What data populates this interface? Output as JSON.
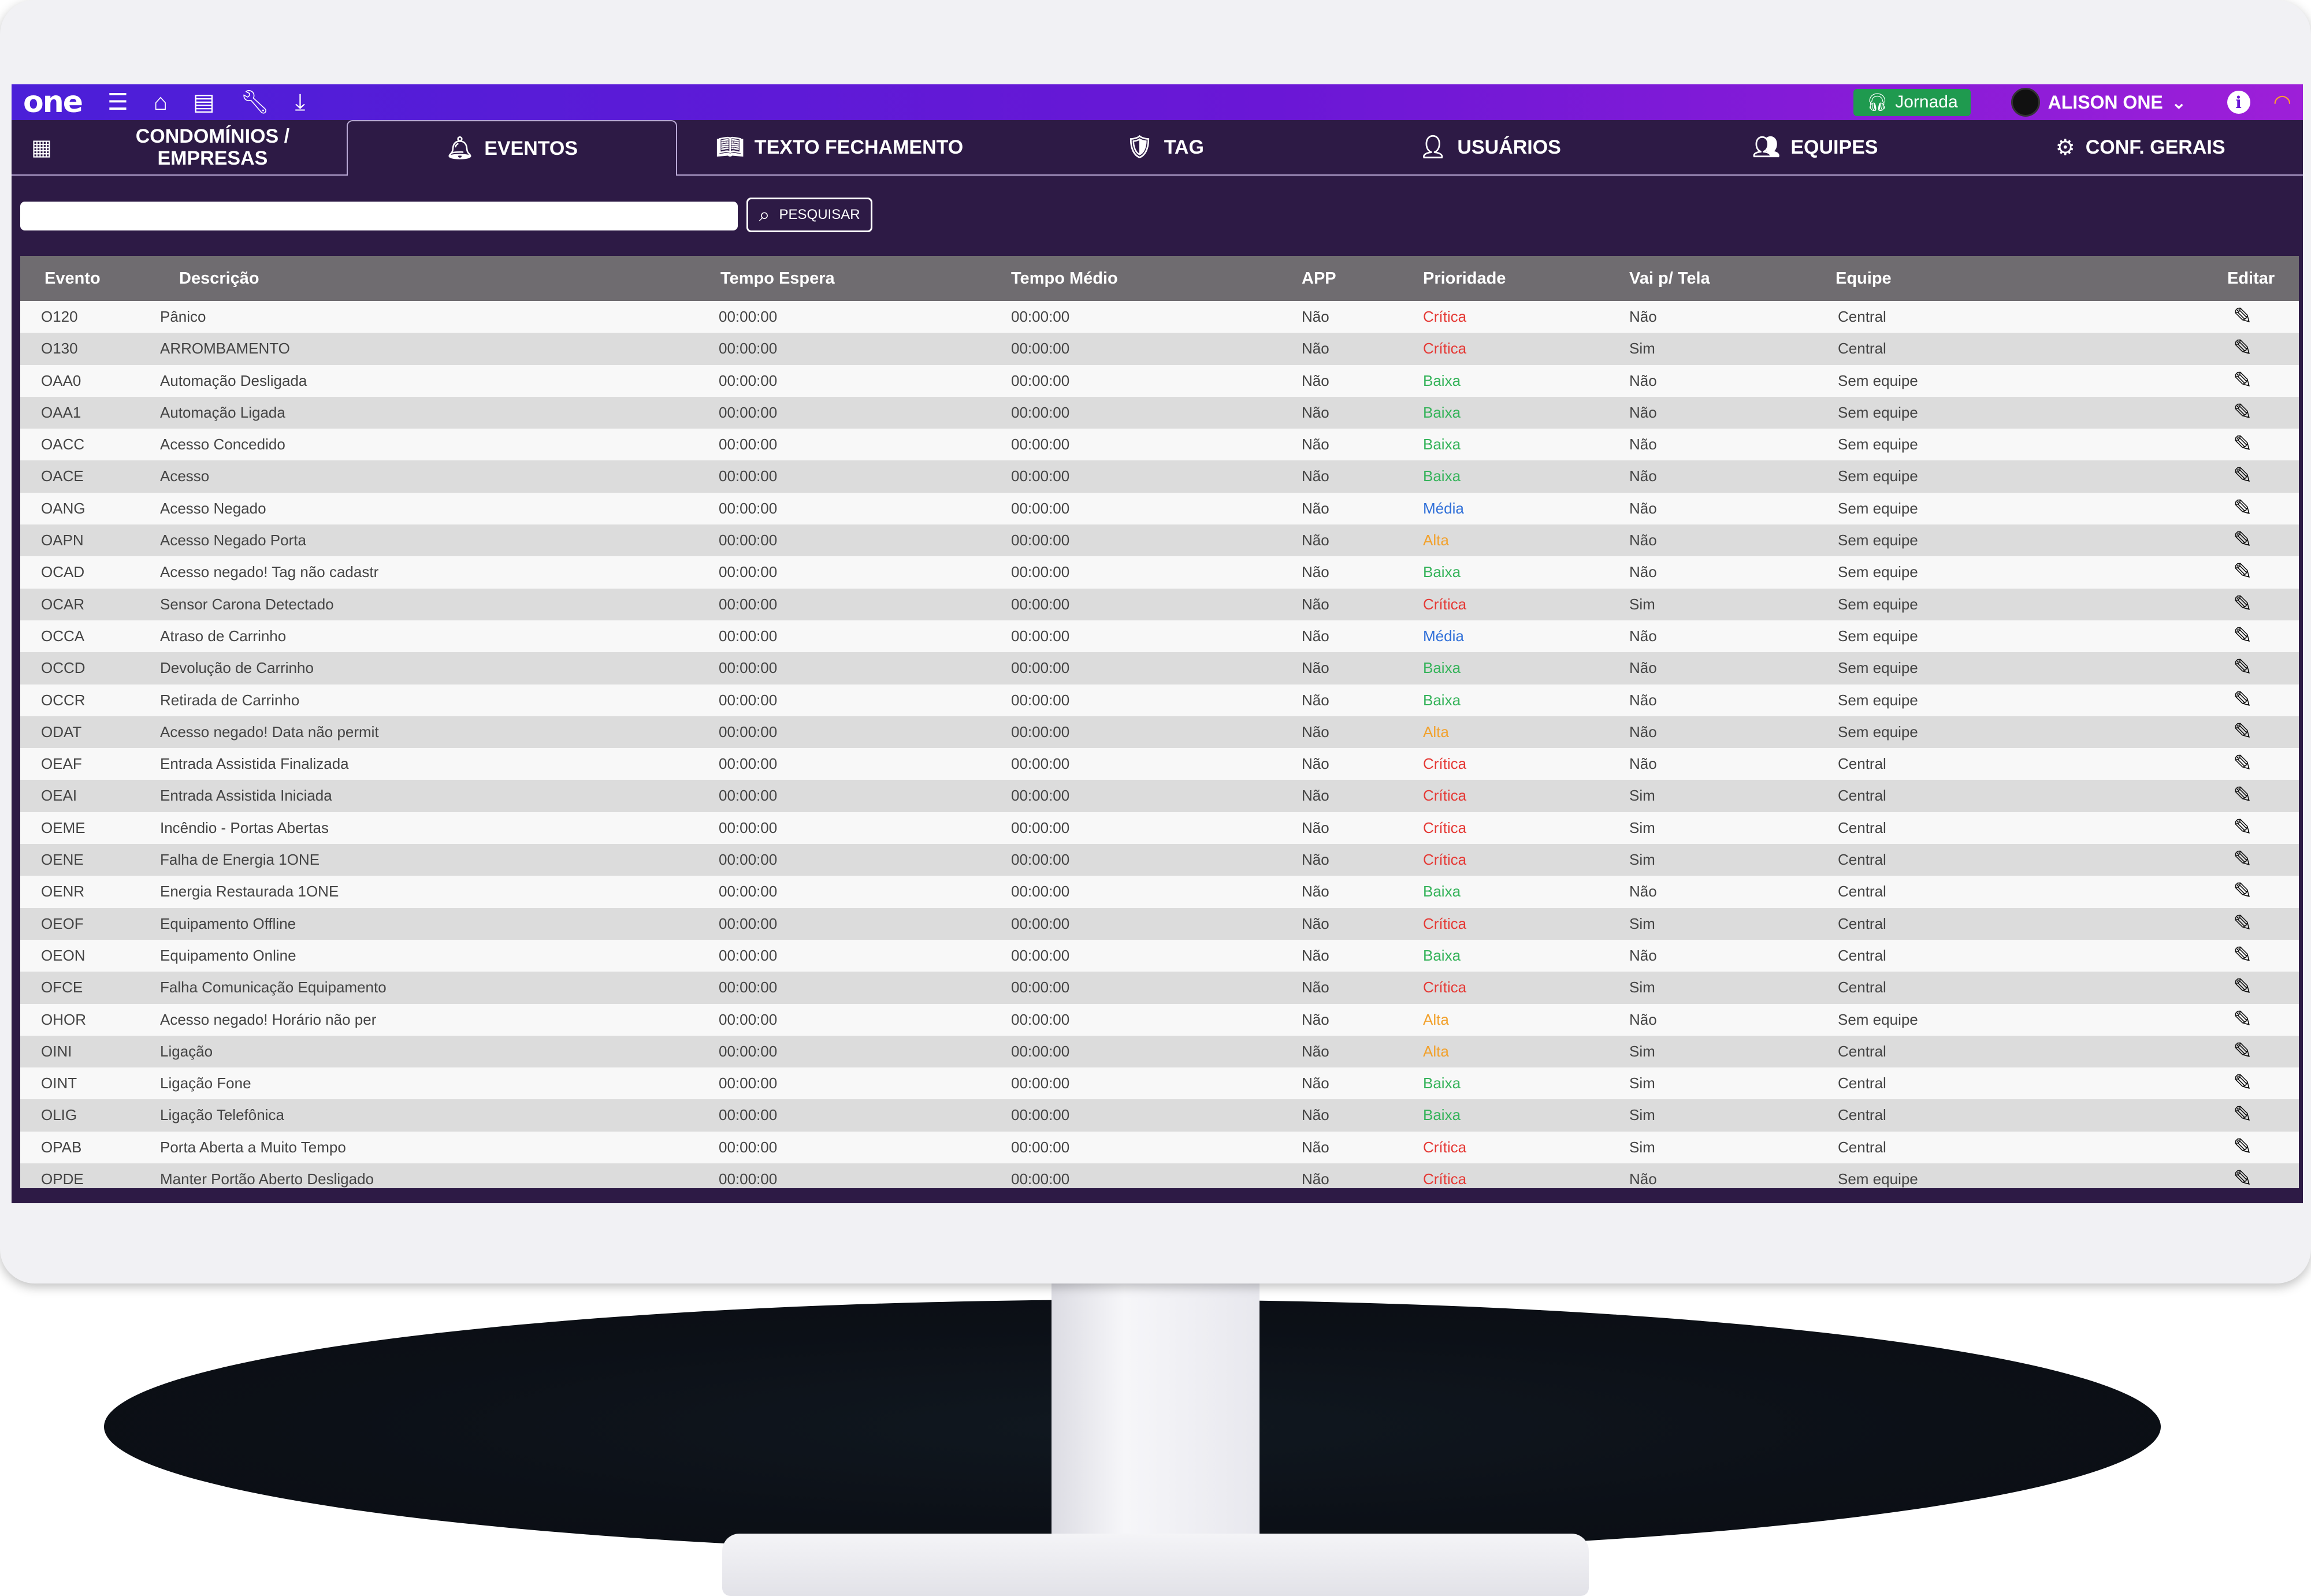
{
  "app": {
    "logo": "one",
    "jornada_label": "Jornada",
    "user_name": "ALISON ONE"
  },
  "icons": {
    "menu": "menu-icon",
    "home": "home-icon",
    "report": "report-icon",
    "tools": "wrench-icon",
    "download": "download-icon",
    "info": "info-icon",
    "wifi": "wifi-icon"
  },
  "colors": {
    "topbar_start": "#4b1fd8",
    "topbar_end": "#9d1fd8",
    "background": "#2d1a45",
    "jornada": "#1f9a4f",
    "critica": "#e53935",
    "baixa": "#35b35a",
    "media": "#2f6fd8",
    "alta": "#f2a12c"
  },
  "tabs": [
    {
      "label": "CONDOMÍNIOS /\nEMPRESAS",
      "icon": "building-icon"
    },
    {
      "label": "EVENTOS",
      "icon": "bell-icon",
      "active": true
    },
    {
      "label": "TEXTO FECHAMENTO",
      "icon": "book-icon"
    },
    {
      "label": "TAG",
      "icon": "shield-check-icon"
    },
    {
      "label": "USUÁRIOS",
      "icon": "user-check-icon"
    },
    {
      "label": "EQUIPES",
      "icon": "users-icon"
    },
    {
      "label": "CONF. GERAIS",
      "icon": "gear-icon"
    }
  ],
  "search": {
    "placeholder": "",
    "button_label": "PESQUISAR"
  },
  "table": {
    "columns": [
      "Evento",
      "Descrição",
      "Tempo Espera",
      "Tempo Médio",
      "APP",
      "Prioridade",
      "Vai p/ Tela",
      "Equipe",
      "Editar"
    ],
    "rows": [
      {
        "evento": "O120",
        "descricao": "Pânico",
        "espera": "00:00:00",
        "medio": "00:00:00",
        "app": "Não",
        "prioridade": "Crítica",
        "tela": "Não",
        "equipe": "Central"
      },
      {
        "evento": "O130",
        "descricao": "ARROMBAMENTO",
        "espera": "00:00:00",
        "medio": "00:00:00",
        "app": "Não",
        "prioridade": "Crítica",
        "tela": "Sim",
        "equipe": "Central"
      },
      {
        "evento": "OAA0",
        "descricao": "Automação Desligada",
        "espera": "00:00:00",
        "medio": "00:00:00",
        "app": "Não",
        "prioridade": "Baixa",
        "tela": "Não",
        "equipe": "Sem equipe"
      },
      {
        "evento": "OAA1",
        "descricao": "Automação Ligada",
        "espera": "00:00:00",
        "medio": "00:00:00",
        "app": "Não",
        "prioridade": "Baixa",
        "tela": "Não",
        "equipe": "Sem equipe"
      },
      {
        "evento": "OACC",
        "descricao": "Acesso Concedido",
        "espera": "00:00:00",
        "medio": "00:00:00",
        "app": "Não",
        "prioridade": "Baixa",
        "tela": "Não",
        "equipe": "Sem equipe"
      },
      {
        "evento": "OACE",
        "descricao": "Acesso",
        "espera": "00:00:00",
        "medio": "00:00:00",
        "app": "Não",
        "prioridade": "Baixa",
        "tela": "Não",
        "equipe": "Sem equipe"
      },
      {
        "evento": "OANG",
        "descricao": "Acesso Negado",
        "espera": "00:00:00",
        "medio": "00:00:00",
        "app": "Não",
        "prioridade": "Média",
        "tela": "Não",
        "equipe": "Sem equipe"
      },
      {
        "evento": "OAPN",
        "descricao": "Acesso Negado Porta",
        "espera": "00:00:00",
        "medio": "00:00:00",
        "app": "Não",
        "prioridade": "Alta",
        "tela": "Não",
        "equipe": "Sem equipe"
      },
      {
        "evento": "OCAD",
        "descricao": "Acesso negado! Tag não cadastr",
        "espera": "00:00:00",
        "medio": "00:00:00",
        "app": "Não",
        "prioridade": "Baixa",
        "tela": "Não",
        "equipe": "Sem equipe"
      },
      {
        "evento": "OCAR",
        "descricao": "Sensor Carona Detectado",
        "espera": "00:00:00",
        "medio": "00:00:00",
        "app": "Não",
        "prioridade": "Crítica",
        "tela": "Sim",
        "equipe": "Sem equipe"
      },
      {
        "evento": "OCCA",
        "descricao": "Atraso de Carrinho",
        "espera": "00:00:00",
        "medio": "00:00:00",
        "app": "Não",
        "prioridade": "Média",
        "tela": "Não",
        "equipe": "Sem equipe"
      },
      {
        "evento": "OCCD",
        "descricao": "Devolução de Carrinho",
        "espera": "00:00:00",
        "medio": "00:00:00",
        "app": "Não",
        "prioridade": "Baixa",
        "tela": "Não",
        "equipe": "Sem equipe"
      },
      {
        "evento": "OCCR",
        "descricao": "Retirada de Carrinho",
        "espera": "00:00:00",
        "medio": "00:00:00",
        "app": "Não",
        "prioridade": "Baixa",
        "tela": "Não",
        "equipe": "Sem equipe"
      },
      {
        "evento": "ODAT",
        "descricao": "Acesso negado! Data não permit",
        "espera": "00:00:00",
        "medio": "00:00:00",
        "app": "Não",
        "prioridade": "Alta",
        "tela": "Não",
        "equipe": "Sem equipe"
      },
      {
        "evento": "OEAF",
        "descricao": "Entrada Assistida Finalizada",
        "espera": "00:00:00",
        "medio": "00:00:00",
        "app": "Não",
        "prioridade": "Crítica",
        "tela": "Não",
        "equipe": "Central"
      },
      {
        "evento": "OEAI",
        "descricao": "Entrada Assistida Iniciada",
        "espera": "00:00:00",
        "medio": "00:00:00",
        "app": "Não",
        "prioridade": "Crítica",
        "tela": "Sim",
        "equipe": "Central"
      },
      {
        "evento": "OEME",
        "descricao": "Incêndio - Portas Abertas",
        "espera": "00:00:00",
        "medio": "00:00:00",
        "app": "Não",
        "prioridade": "Crítica",
        "tela": "Sim",
        "equipe": "Central"
      },
      {
        "evento": "OENE",
        "descricao": "Falha de Energia 1ONE",
        "espera": "00:00:00",
        "medio": "00:00:00",
        "app": "Não",
        "prioridade": "Crítica",
        "tela": "Sim",
        "equipe": "Central"
      },
      {
        "evento": "OENR",
        "descricao": "Energia Restaurada 1ONE",
        "espera": "00:00:00",
        "medio": "00:00:00",
        "app": "Não",
        "prioridade": "Baixa",
        "tela": "Não",
        "equipe": "Central"
      },
      {
        "evento": "OEOF",
        "descricao": "Equipamento Offline",
        "espera": "00:00:00",
        "medio": "00:00:00",
        "app": "Não",
        "prioridade": "Crítica",
        "tela": "Sim",
        "equipe": "Central"
      },
      {
        "evento": "OEON",
        "descricao": "Equipamento Online",
        "espera": "00:00:00",
        "medio": "00:00:00",
        "app": "Não",
        "prioridade": "Baixa",
        "tela": "Não",
        "equipe": "Central"
      },
      {
        "evento": "OFCE",
        "descricao": "Falha Comunicação Equipamento",
        "espera": "00:00:00",
        "medio": "00:00:00",
        "app": "Não",
        "prioridade": "Crítica",
        "tela": "Sim",
        "equipe": "Central"
      },
      {
        "evento": "OHOR",
        "descricao": "Acesso negado! Horário não per",
        "espera": "00:00:00",
        "medio": "00:00:00",
        "app": "Não",
        "prioridade": "Alta",
        "tela": "Não",
        "equipe": "Sem equipe"
      },
      {
        "evento": "OINI",
        "descricao": "Ligação",
        "espera": "00:00:00",
        "medio": "00:00:00",
        "app": "Não",
        "prioridade": "Alta",
        "tela": "Sim",
        "equipe": "Central"
      },
      {
        "evento": "OINT",
        "descricao": "Ligação Fone",
        "espera": "00:00:00",
        "medio": "00:00:00",
        "app": "Não",
        "prioridade": "Baixa",
        "tela": "Sim",
        "equipe": "Central"
      },
      {
        "evento": "OLIG",
        "descricao": "Ligação Telefônica",
        "espera": "00:00:00",
        "medio": "00:00:00",
        "app": "Não",
        "prioridade": "Baixa",
        "tela": "Sim",
        "equipe": "Central"
      },
      {
        "evento": "OPAB",
        "descricao": "Porta Aberta a Muito Tempo",
        "espera": "00:00:00",
        "medio": "00:00:00",
        "app": "Não",
        "prioridade": "Crítica",
        "tela": "Sim",
        "equipe": "Central"
      },
      {
        "evento": "OPDE",
        "descricao": "Manter Portão Aberto Desligado",
        "espera": "00:00:00",
        "medio": "00:00:00",
        "app": "Não",
        "prioridade": "Crítica",
        "tela": "Não",
        "equipe": "Sem equipe"
      }
    ]
  }
}
